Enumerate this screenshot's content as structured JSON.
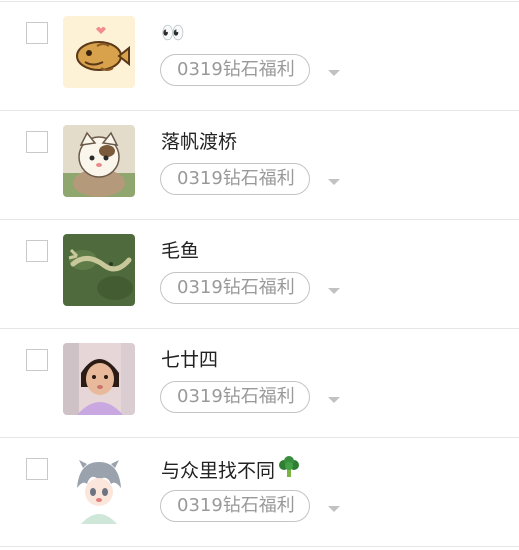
{
  "members": [
    {
      "name": "👀",
      "tag": "0319钻石福利",
      "avatar": "pixel-fish-avatar"
    },
    {
      "name": "落帆渡桥",
      "tag": "0319钻石福利",
      "avatar": "cartoon-cat-avatar"
    },
    {
      "name": "毛鱼",
      "tag": "0319钻石福利",
      "avatar": "green-fish-avatar"
    },
    {
      "name": "七廿四",
      "tag": "0319钻石福利",
      "avatar": "child-photo-avatar"
    },
    {
      "name": "与众里找不同",
      "tag": "0319钻石福利",
      "avatar": "anime-boy-avatar",
      "name_emoji": "broccoli-icon"
    }
  ]
}
